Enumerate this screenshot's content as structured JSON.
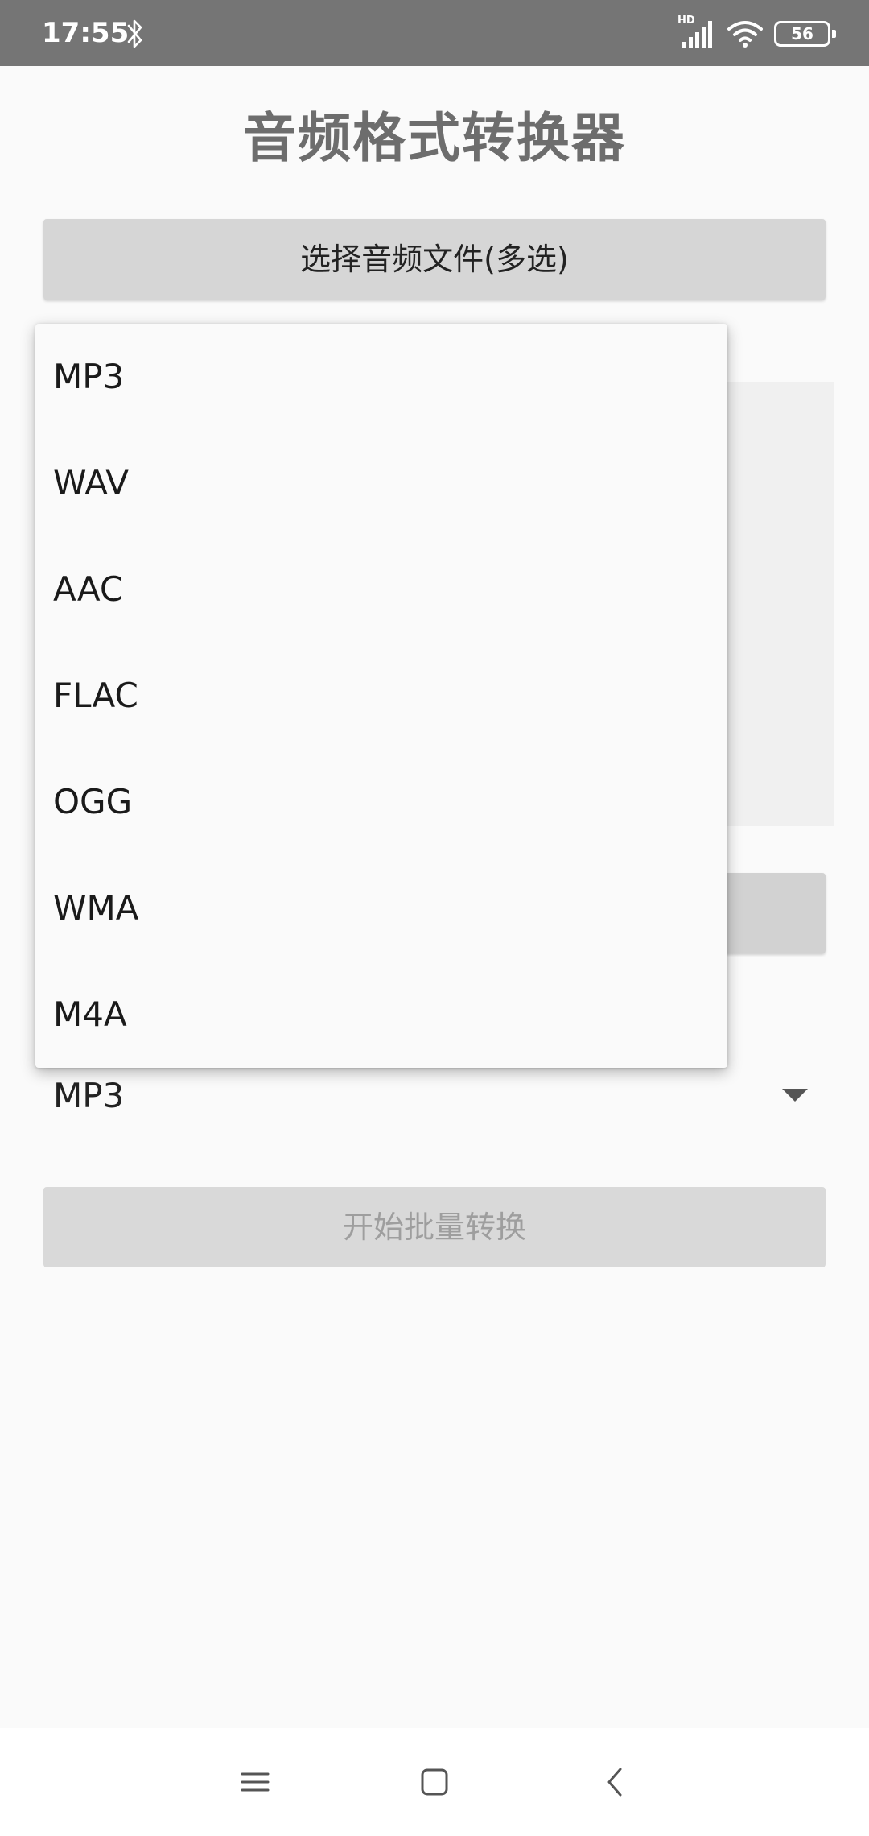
{
  "status_bar": {
    "time": "17:55",
    "network_label": "HD",
    "battery_level": "56"
  },
  "app": {
    "title": "音频格式转换器"
  },
  "buttons": {
    "select_files": "选择音频文件(多选)",
    "start_batch": "开始批量转换"
  },
  "format_spinner": {
    "selected": "MP3",
    "options": [
      "MP3",
      "WAV",
      "AAC",
      "FLAC",
      "OGG",
      "WMA",
      "M4A"
    ]
  },
  "colors": {
    "status_bar": "#757575",
    "title": "#6d6d6d",
    "button_bg": "#d6d6d6",
    "disabled_text": "#9e9e9e"
  }
}
